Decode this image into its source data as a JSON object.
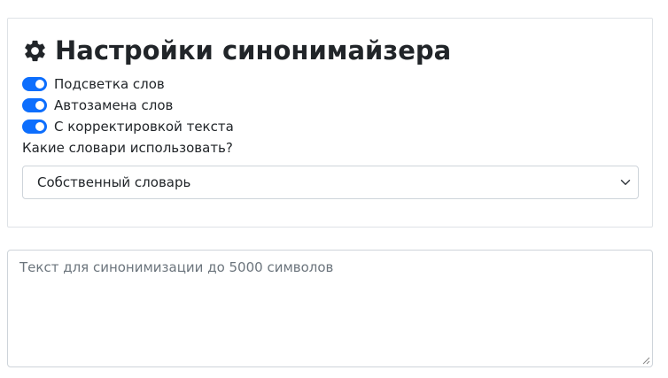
{
  "settings": {
    "title": "Настройки синонимайзера",
    "title_icon": "gear-icon",
    "switches": [
      {
        "label": "Подсветка слов",
        "checked": true
      },
      {
        "label": "Автозамена слов",
        "checked": true
      },
      {
        "label": "С корректировкой текста",
        "checked": true
      }
    ],
    "dictionary_label": "Какие словари использовать?",
    "dictionary_selected": "Собственный словарь"
  },
  "input": {
    "placeholder": "Текст для синонимизации до 5000 символов"
  },
  "colors": {
    "accent": "#0d6efd",
    "border": "#dee2e6",
    "placeholder": "#6c757d"
  }
}
